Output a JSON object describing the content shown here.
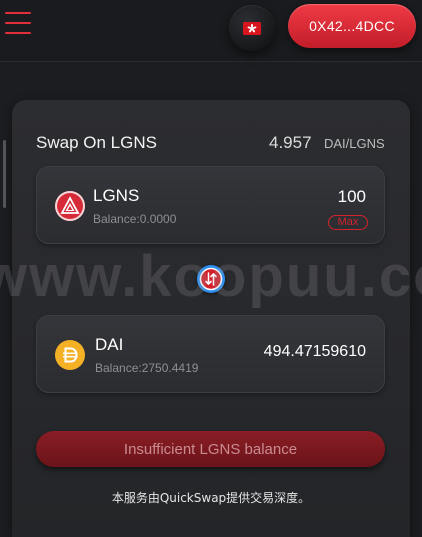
{
  "header": {
    "menu_icon": "hamburger-menu-icon",
    "language_icon": "hong-kong-flag-icon",
    "wallet_address": "0X42...4DCC",
    "accent_color": "#e0303a"
  },
  "swap": {
    "title": "Swap On LGNS",
    "rate_value": "4.957",
    "rate_unit": "DAI/LGNS",
    "from": {
      "icon": "lgns-token-icon",
      "symbol": "LGNS",
      "balance": "Balance:0.0000",
      "amount": "100",
      "max_label": "Max"
    },
    "switch_icon": "swap-direction-icon",
    "to": {
      "icon": "dai-token-icon",
      "symbol": "DAI",
      "balance": "Balance:2750.4419",
      "amount": "494.47159610"
    },
    "submit_label": "Insufficient LGNS balance",
    "footer_note": "本服务由QuickSwap提供交易深度。"
  },
  "watermark": {
    "text": "www.koopuu.com"
  }
}
